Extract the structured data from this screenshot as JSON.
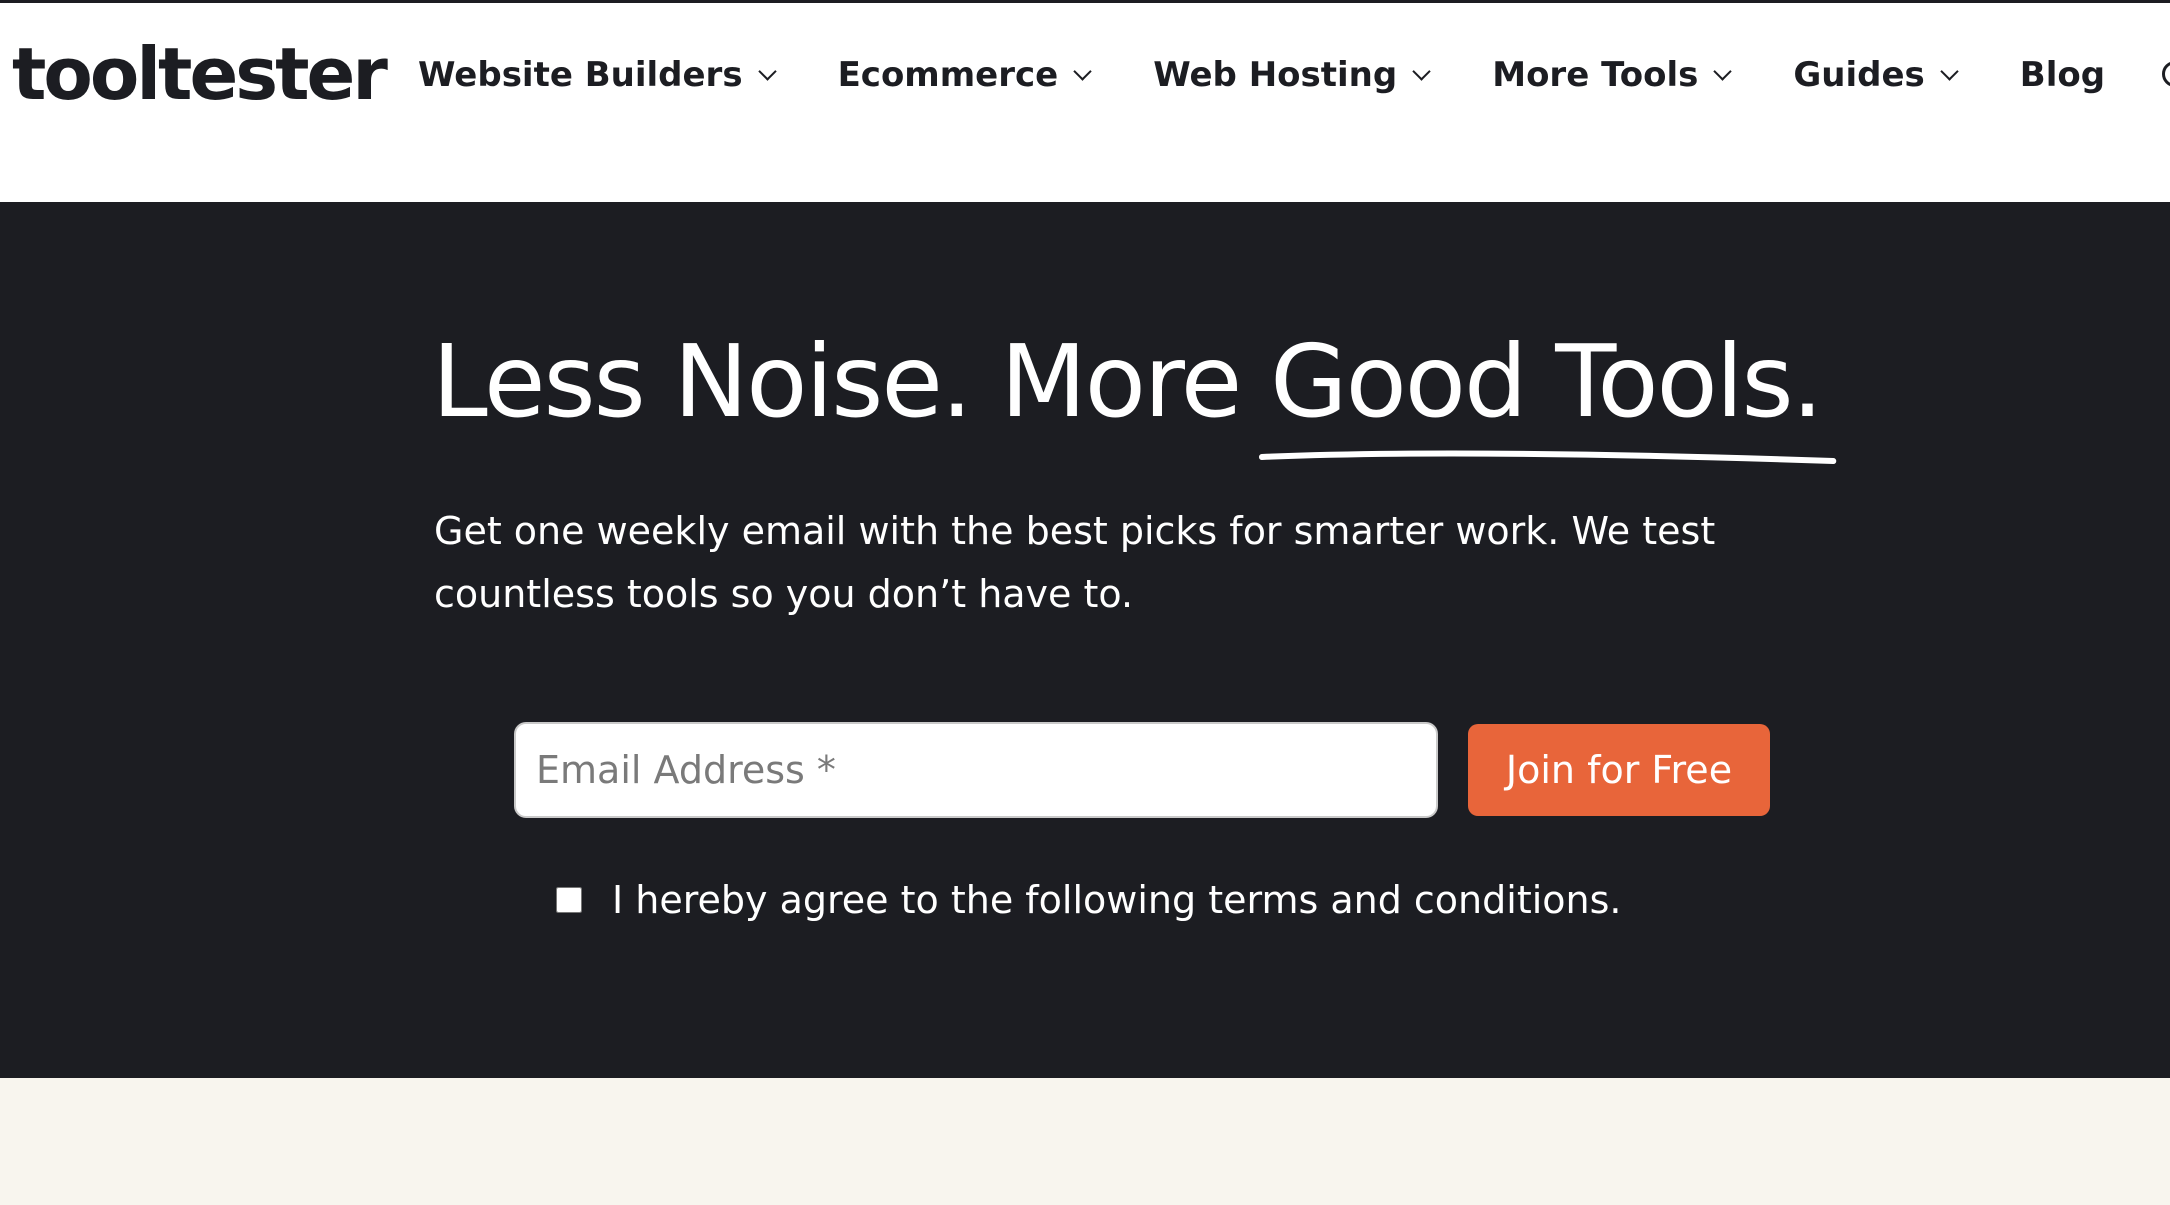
{
  "brand": {
    "logo_text": "tooltester"
  },
  "nav": {
    "items": [
      {
        "label": "Website Builders",
        "has_dropdown": true
      },
      {
        "label": "Ecommerce",
        "has_dropdown": true
      },
      {
        "label": "Web Hosting",
        "has_dropdown": true
      },
      {
        "label": "More Tools",
        "has_dropdown": true
      },
      {
        "label": "Guides",
        "has_dropdown": true
      },
      {
        "label": "Blog",
        "has_dropdown": false
      }
    ],
    "trailing_icon": "search-icon"
  },
  "hero": {
    "title_part1": "Less Noise. More ",
    "title_part2": "Good Tools.",
    "description": "Get one weekly email with the best picks for smarter work. We test countless tools so you don’t have to.",
    "email_placeholder": "Email Address *",
    "email_value": "",
    "join_button": "Join for Free",
    "agree_label": "I hereby agree to the following terms and conditions.",
    "agree_checked": false
  },
  "colors": {
    "hero_bg": "#1c1d22",
    "accent": "#e8653a",
    "page_bg": "#f8f5ee",
    "header_bg": "#ffffff"
  }
}
